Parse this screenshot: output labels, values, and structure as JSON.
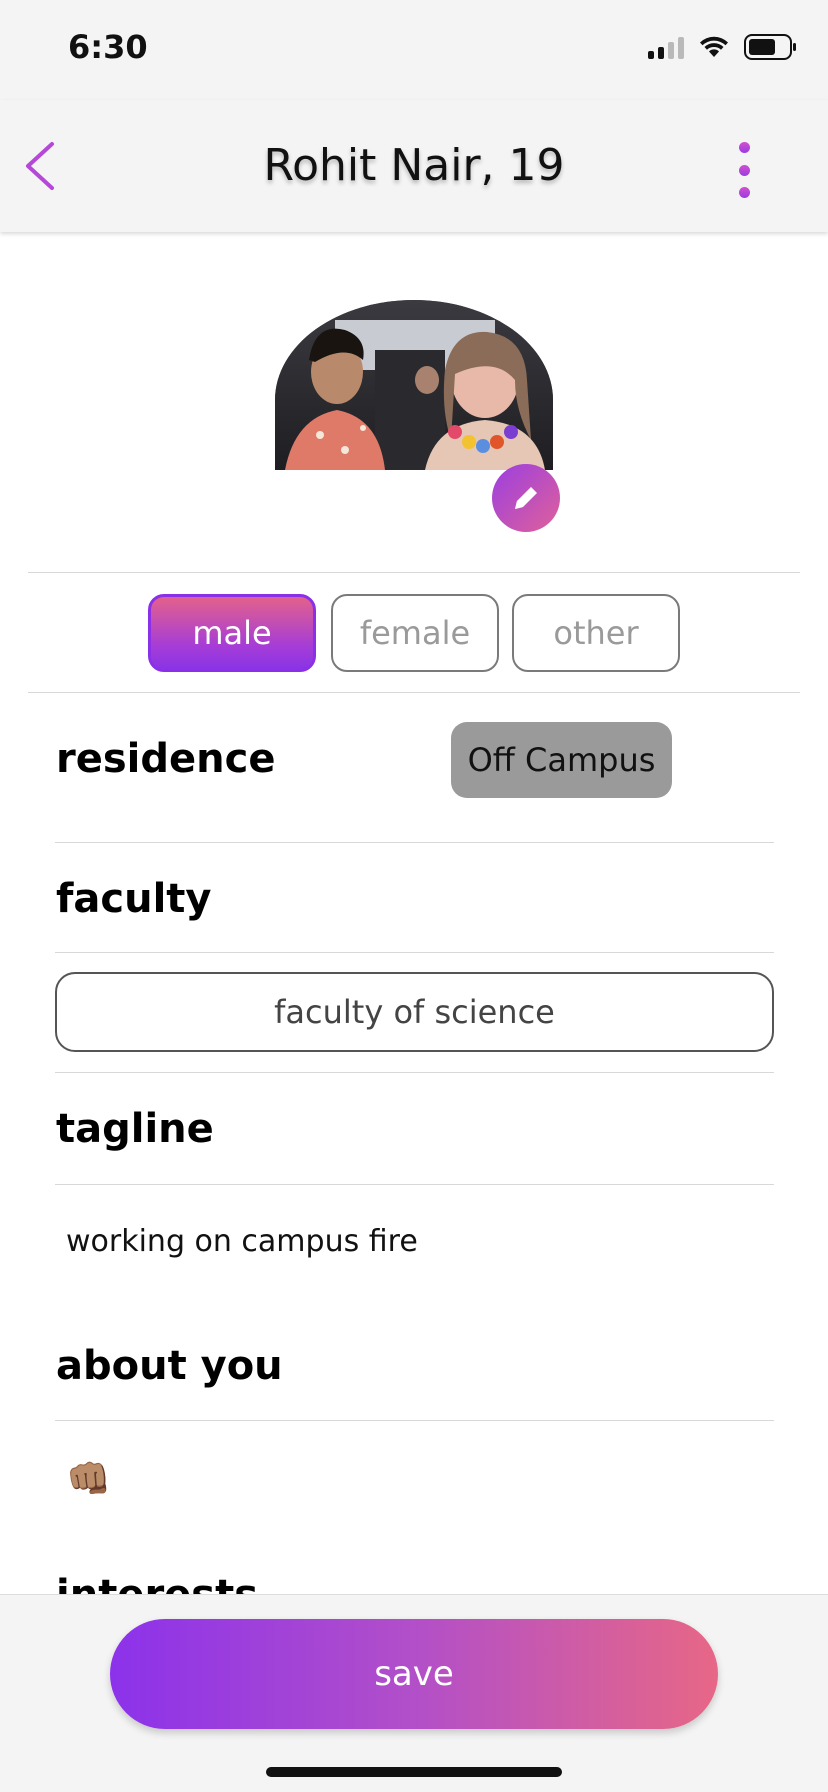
{
  "status_bar": {
    "time": "6:30"
  },
  "header": {
    "title": "Rohit Nair, 19",
    "accent_color": "#b548d8"
  },
  "profile": {
    "avatar_alt": "profile photo"
  },
  "gender": {
    "options": [
      "male",
      "female",
      "other"
    ],
    "selected": "male"
  },
  "residence": {
    "label": "residence",
    "value": "Off Campus"
  },
  "faculty": {
    "label": "faculty",
    "value": "faculty of science"
  },
  "tagline": {
    "label": "tagline",
    "value": "working on campus fire"
  },
  "about": {
    "label": "about you",
    "value": "👊🏽"
  },
  "interests": {
    "label": "interests"
  },
  "footer": {
    "save_label": "save",
    "gradient_start": "#8c32ea",
    "gradient_end": "#e76786"
  }
}
